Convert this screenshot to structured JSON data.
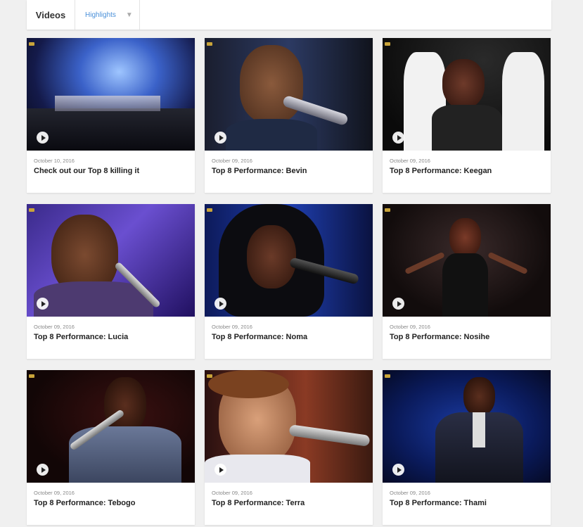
{
  "header": {
    "tab_label": "Videos",
    "filter_label": "Highlights"
  },
  "videos": [
    {
      "date": "October 10, 2016",
      "title": "Check out our Top 8 killing it"
    },
    {
      "date": "October 09, 2016",
      "title": "Top 8 Performance: Bevin"
    },
    {
      "date": "October 09, 2016",
      "title": "Top 8 Performance: Keegan"
    },
    {
      "date": "October 09, 2016",
      "title": "Top 8 Performance: Lucia"
    },
    {
      "date": "October 09, 2016",
      "title": "Top 8 Performance: Noma"
    },
    {
      "date": "October 09, 2016",
      "title": "Top 8 Performance: Nosihe"
    },
    {
      "date": "October 09, 2016",
      "title": "Top 8 Performance: Tebogo"
    },
    {
      "date": "October 09, 2016",
      "title": "Top 8 Performance: Terra"
    },
    {
      "date": "October 09, 2016",
      "title": "Top 8 Performance: Thami"
    }
  ],
  "icons": {
    "play": "play-icon",
    "dropdown": "chevron-down-icon",
    "channel_logo": "channel-logo-icon"
  },
  "colors": {
    "accent_link": "#4a90d9",
    "page_bg": "#f0f0f0"
  }
}
